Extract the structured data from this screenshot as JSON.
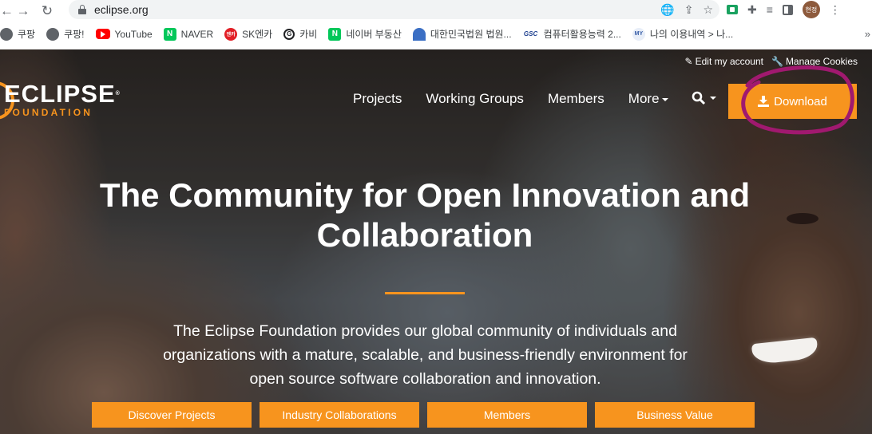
{
  "browser": {
    "url": "eclipse.org",
    "profile_initials": "현정"
  },
  "bookmarks": [
    {
      "label": "쿠팡",
      "icon": "globe-icon"
    },
    {
      "label": "쿠팡!",
      "icon": "globe-icon"
    },
    {
      "label": "YouTube",
      "icon": "youtube-icon"
    },
    {
      "label": "NAVER",
      "icon": "naver-icon"
    },
    {
      "label": "SK엔카",
      "icon": "sk-encar-icon"
    },
    {
      "label": "카비",
      "icon": "cavi-icon"
    },
    {
      "label": "네이버 부동산",
      "icon": "naver-icon"
    },
    {
      "label": "대한민국법원 법원...",
      "icon": "court-icon"
    },
    {
      "label": "컴퓨터활용능력 2...",
      "icon": "gsc-icon"
    },
    {
      "label": "나의 이용내역 > 나...",
      "icon": "my-usage-icon"
    }
  ],
  "site": {
    "logo_word": "ECLIPSE",
    "logo_sub": "FOUNDATION",
    "top_links": {
      "edit_account": "Edit my account",
      "manage_cookies": "Manage Cookies"
    },
    "nav": {
      "projects": "Projects",
      "working_groups": "Working Groups",
      "members": "Members",
      "more": "More"
    },
    "download_label": "Download"
  },
  "hero": {
    "title_line1": "The Community for Open Innovation and",
    "title_line2": "Collaboration",
    "description": "The Eclipse Foundation provides our global community of individuals and organizations with a mature, scalable, and business-friendly environment for open source software collaboration and innovation.",
    "ctas": [
      "Discover Projects",
      "Industry Collaborations",
      "Members",
      "Business Value"
    ]
  },
  "colors": {
    "accent": "#f7941e",
    "annotation": "#a0196f"
  }
}
